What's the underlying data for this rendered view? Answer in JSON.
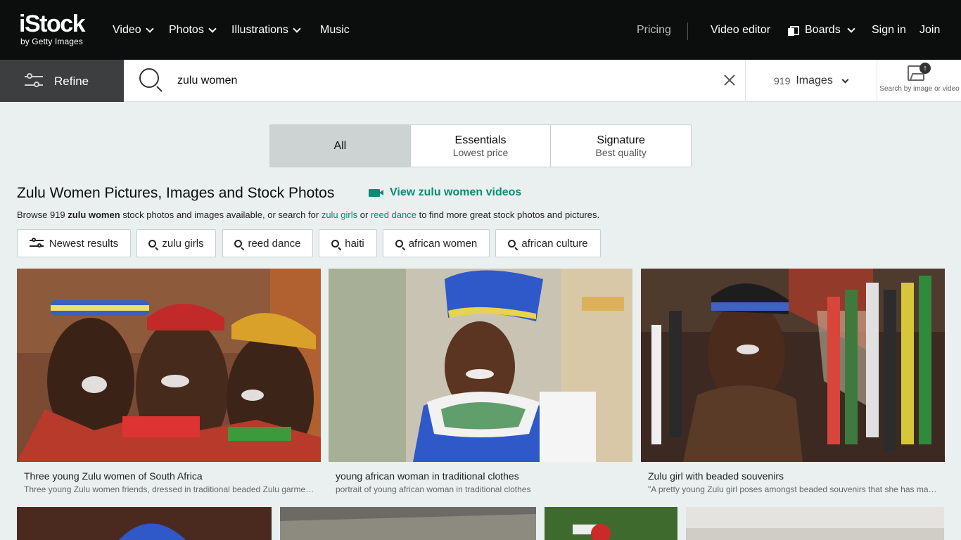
{
  "brand": {
    "name": "iStock",
    "sub": "by Getty Images"
  },
  "nav": {
    "left": [
      {
        "label": "Video",
        "dropdown": true
      },
      {
        "label": "Photos",
        "dropdown": true
      },
      {
        "label": "Illustrations",
        "dropdown": true
      },
      {
        "label": "Music",
        "dropdown": false
      }
    ],
    "pricing": "Pricing",
    "video_editor": "Video editor",
    "boards": "Boards",
    "sign_in": "Sign in",
    "join": "Join"
  },
  "search": {
    "refine_label": "Refine",
    "query": "zulu women",
    "result_count": "919",
    "result_type": "Images",
    "search_by_image": "Search by image or video"
  },
  "tabs": [
    {
      "title": "All",
      "subtitle": "",
      "active": true
    },
    {
      "title": "Essentials",
      "subtitle": "Lowest price",
      "active": false
    },
    {
      "title": "Signature",
      "subtitle": "Best quality",
      "active": false
    }
  ],
  "heading": {
    "title": "Zulu Women Pictures, Images and Stock Photos",
    "video_link": "View zulu women videos"
  },
  "browse": {
    "prefix": "Browse 919 ",
    "query": "zulu women",
    "middle": " stock photos and images available, or search for ",
    "link1": "zulu girls",
    "or": " or ",
    "link2": "reed dance",
    "suffix": " to find more great stock photos and pictures."
  },
  "chips": [
    "Newest results",
    "zulu girls",
    "reed dance",
    "haiti",
    "african women",
    "african culture"
  ],
  "results": [
    {
      "title": "Three young Zulu women of South Africa",
      "description": "Three young Zulu women friends, dressed in traditional beaded Zulu garments, laugh together"
    },
    {
      "title": "young african woman in traditional clothes",
      "description": "portrait of young african woman in traditional clothes"
    },
    {
      "title": "Zulu girl with beaded souvenirs",
      "description": "\"A pretty young Zulu girl poses amongst beaded souvenirs that she has made for sale\""
    }
  ],
  "colors": {
    "nav_bg": "#0c0d0d",
    "accent": "#0a8b75",
    "page_bg": "#eaf0ef",
    "refine_bg": "#3c3e3f"
  }
}
